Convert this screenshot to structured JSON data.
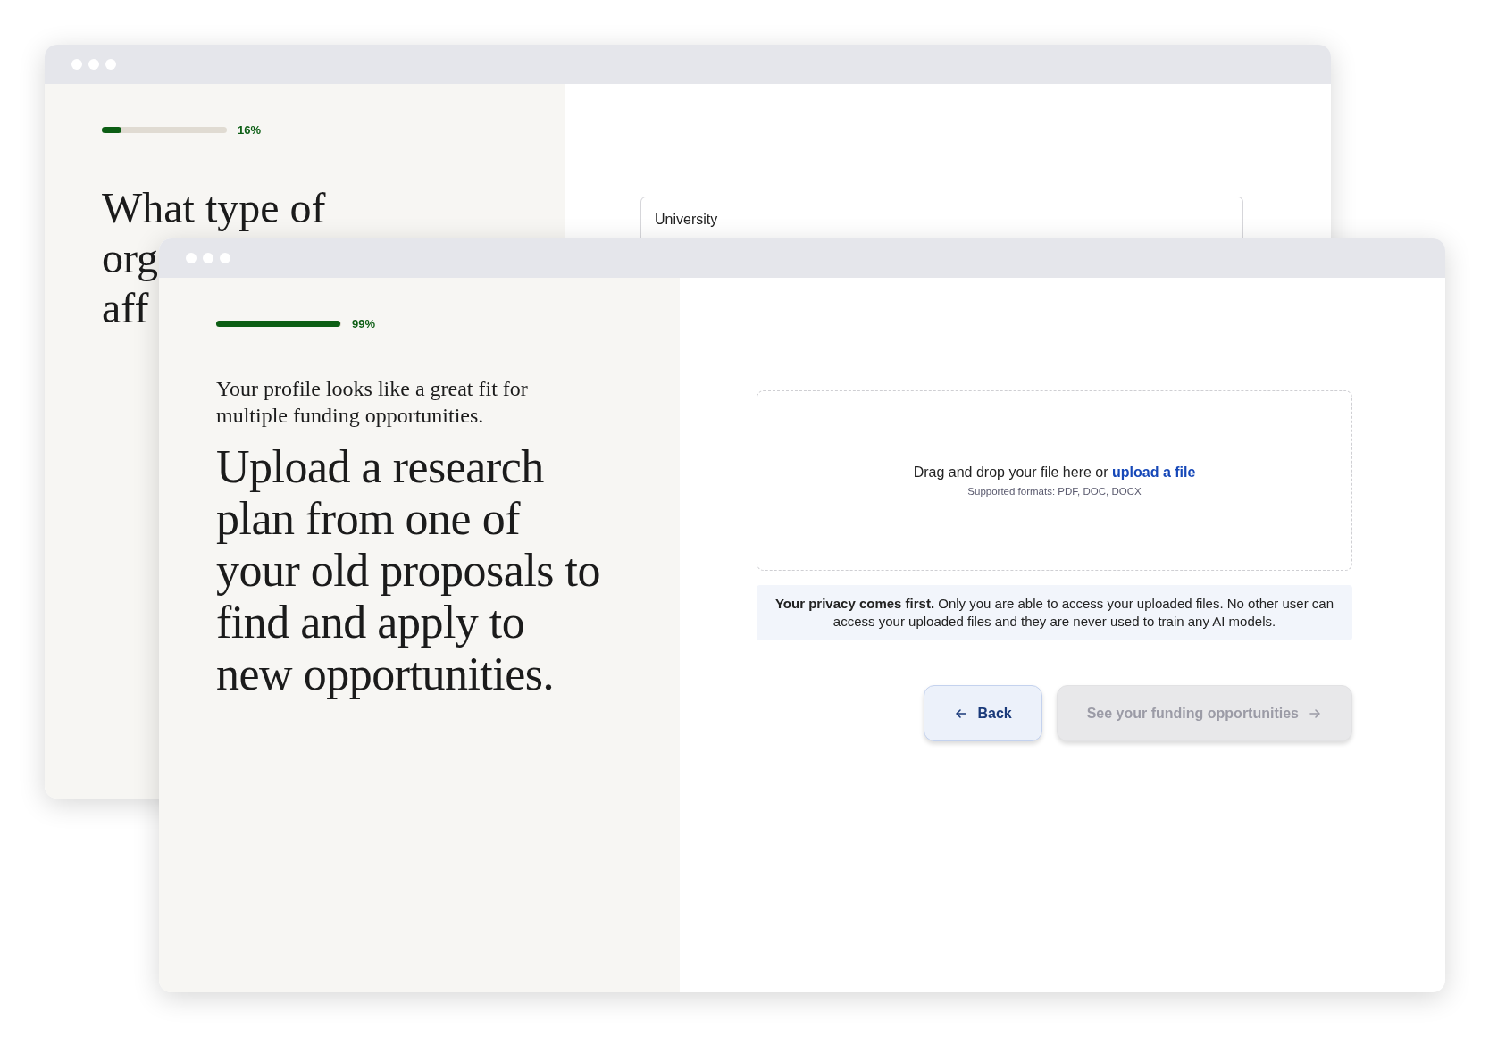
{
  "windows": [
    {
      "kind": "question",
      "progress": {
        "level": 0.16,
        "label": "16%"
      },
      "heading_lines": [
        "What type of",
        "org",
        "aff"
      ],
      "field": {
        "value": "University"
      }
    },
    {
      "kind": "upload",
      "progress": {
        "level": 0.99,
        "label": "99%"
      },
      "intro": "Your profile looks like a great fit for multiple funding opportunities.",
      "heading": "Upload a research plan from one of your old proposals to find and apply to new opportunities.",
      "dropzone": {
        "text": "Drag and drop your file here or",
        "link": "upload a file",
        "formats": "Supported formats: PDF, DOC, DOCX"
      },
      "notice": "**Your privacy comes first.** Only you are able to access your uploaded files. No other user can access your uploaded files and they are never used to train any AI models.",
      "buttons": [
        {
          "label": "Back",
          "kind": "back",
          "disabled": false
        },
        {
          "label": "See your funding opportunities",
          "kind": "forward",
          "disabled": true
        }
      ]
    }
  ]
}
